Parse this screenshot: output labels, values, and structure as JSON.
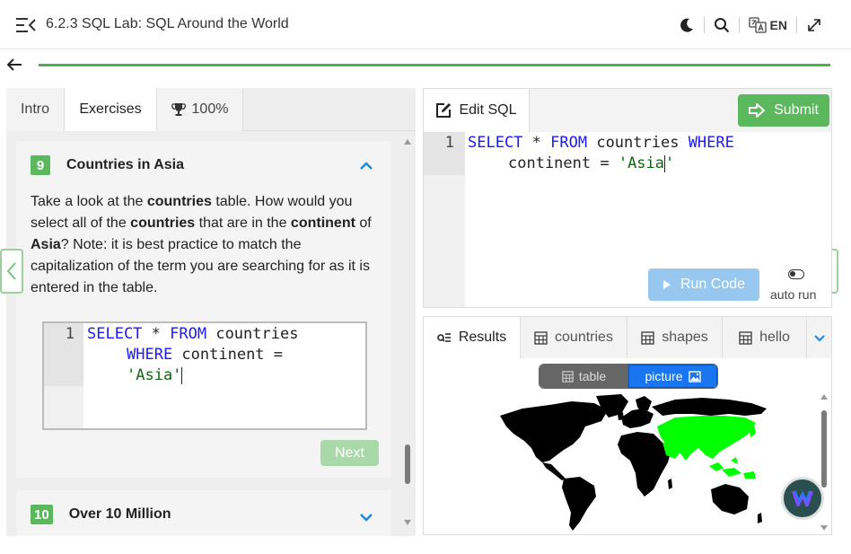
{
  "header": {
    "title": "6.2.3 SQL Lab: SQL Around the World",
    "language": "EN"
  },
  "progress": {
    "percent": 100
  },
  "left_tabs": {
    "intro": "Intro",
    "exercises": "Exercises",
    "score": "100%"
  },
  "exercise": {
    "number": "9",
    "title": "Countries in Asia",
    "text_parts": [
      "Take a look at the ",
      "countries",
      " table. How would you select all of the ",
      "countries",
      " that are in the ",
      "continent",
      " of ",
      "Asia",
      "? Note: it is best practice to match the capitalization of the term you are searching for as it is entered in the table."
    ],
    "code": {
      "line_number": "1",
      "kw_select": "SELECT",
      "star": " * ",
      "kw_from": "FROM",
      "table": " countries",
      "kw_where": "WHERE",
      "col": " continent =",
      "value": "'Asia'"
    },
    "next_label": "Next"
  },
  "exercise_next": {
    "number": "10",
    "title": "Over 10 Million"
  },
  "editor": {
    "tab_label": "Edit SQL",
    "submit_label": "Submit",
    "line_number": "1",
    "kw_select": "SELECT",
    "star": " * ",
    "kw_from": "FROM",
    "table": " countries ",
    "kw_where": "WHERE",
    "col": "continent = ",
    "value_open": "'Asia",
    "value_close": "'",
    "run_label": "Run Code",
    "auto_run_label": "auto run"
  },
  "results": {
    "tabs": [
      "Results",
      "countries",
      "shapes",
      "hello"
    ],
    "view_table": "table",
    "view_picture": "picture",
    "map_colors": {
      "land": "#000000",
      "highlight": "#00ff00"
    }
  },
  "colors": {
    "accent_green": "#5cb85c",
    "run_blue": "#98c8f0",
    "picture_blue": "#1976f0"
  }
}
